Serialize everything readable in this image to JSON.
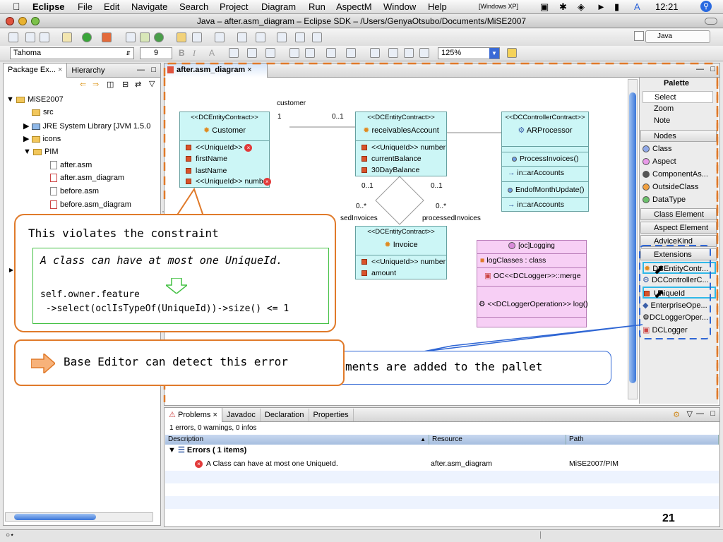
{
  "menubar": {
    "app": "Eclipse",
    "items": [
      "File",
      "Edit",
      "Navigate",
      "Search",
      "Project",
      "Diagram",
      "Run",
      "AspectM",
      "Window",
      "Help"
    ],
    "status_windows": "[Windows XP]",
    "clock": "12:21"
  },
  "window": {
    "title": "Java – after.asm_diagram – Eclipse SDK – /Users/GenyaOtsubo/Documents/MiSE2007"
  },
  "toolbar": {
    "font_name": "Tahoma",
    "font_size": "9",
    "bold": "B",
    "italic": "I",
    "font_color": "A",
    "zoom": "125%",
    "perspective": "Java"
  },
  "package_explorer": {
    "tab_label": "Package Ex...",
    "tab2_label": "Hierarchy",
    "tree": [
      {
        "label": "MiSE2007",
        "kind": "project"
      },
      {
        "label": "src",
        "kind": "package-folder"
      },
      {
        "label": "JRE System Library [JVM 1.5.0",
        "kind": "library"
      },
      {
        "label": "icons",
        "kind": "folder"
      },
      {
        "label": "PIM",
        "kind": "folder"
      },
      {
        "label": "after.asm",
        "kind": "file"
      },
      {
        "label": "after.asm_diagram",
        "kind": "file"
      },
      {
        "label": "before.asm",
        "kind": "file"
      },
      {
        "label": "before.asm_diagram",
        "kind": "file"
      }
    ]
  },
  "editor": {
    "tab_label": "after.asm_diagram",
    "classes": {
      "customer": {
        "stereotype": "<<DCEntityContract>>",
        "name": "Customer",
        "attrs": [
          "<<UniqueId>>",
          "firstName",
          "lastName",
          "<<UniqueId>> numb"
        ]
      },
      "receivables": {
        "stereotype": "<<DCEntityContract>>",
        "name": "receivablesAccount",
        "attrs": [
          "<<UniqueId>> number",
          "currentBalance",
          "30DayBalance"
        ]
      },
      "arprocessor": {
        "stereotype": "<<DCControllerContract>>",
        "name": "ARProcessor",
        "ops": [
          "ProcessInvoices()",
          "in::arAccounts",
          "EndofMonthUpdate()",
          "in::arAccounts"
        ]
      },
      "invoice": {
        "stereotype": "<<DCEntityContract>>",
        "name": "Invoice",
        "attrs": [
          "<<UniqueId>> number",
          "amount"
        ]
      },
      "logging": {
        "name": "[oc]Logging",
        "items": [
          "logClasses : class",
          "OC<<DCLogger>>::merge",
          "<<DCLoggerOperation>> log()"
        ]
      }
    },
    "labels": {
      "customer_role": "customer",
      "mult_1": "1",
      "mult_01": "0..1",
      "mult_left_01": "0..1",
      "mult_right_01": "0..1",
      "mult_left_0s": "0..*",
      "mult_right_0s": "0..*",
      "role_left": "sedInvoices",
      "role_right": "processedInvoices"
    }
  },
  "palette": {
    "title": "Palette",
    "tools": [
      "Select",
      "Zoom",
      "Note"
    ],
    "nodes_label": "Nodes",
    "nodes": [
      "Class",
      "Aspect",
      "ComponentAs...",
      "OutsideClass",
      "DataType"
    ],
    "categories": [
      "Class Element",
      "Aspect Element",
      "AdviceKind",
      "Extensions"
    ],
    "extensions": [
      "DCEntityContr...",
      "DCControllerC...",
      "UniqueId",
      "EnterpriseOpe...",
      "DCLoggerOper...",
      "DCLogger"
    ]
  },
  "callouts": {
    "constraint_title": "This violates the constraint",
    "constraint_text": "A class can have at most one UniqueId.",
    "ocl_line1": "self.owner.feature",
    "ocl_line2": " ->select(oclIsTypeOf(UniqueId))->size() <= 1",
    "detect": "Base Editor can detect this error",
    "pallet_partial": "ments are added to the pallet"
  },
  "problems": {
    "tabs": [
      "Problems",
      "Javadoc",
      "Declaration",
      "Properties"
    ],
    "summary": "1 errors, 0 warnings, 0 infos",
    "columns": [
      "Description",
      "Resource",
      "Path"
    ],
    "group": "Errors ( 1 items)",
    "rows": [
      {
        "description": "A Class can have at most one UniqueId.",
        "resource": "after.asm_diagram",
        "path": "MiSE2007/PIM"
      }
    ]
  },
  "slide_number": "21",
  "colors": {
    "accent_orange": "#e07a2a",
    "diagram_cyan": "#ccf6f6",
    "logger_pink": "#f7cff5",
    "callout_blue": "#2f66d4"
  }
}
